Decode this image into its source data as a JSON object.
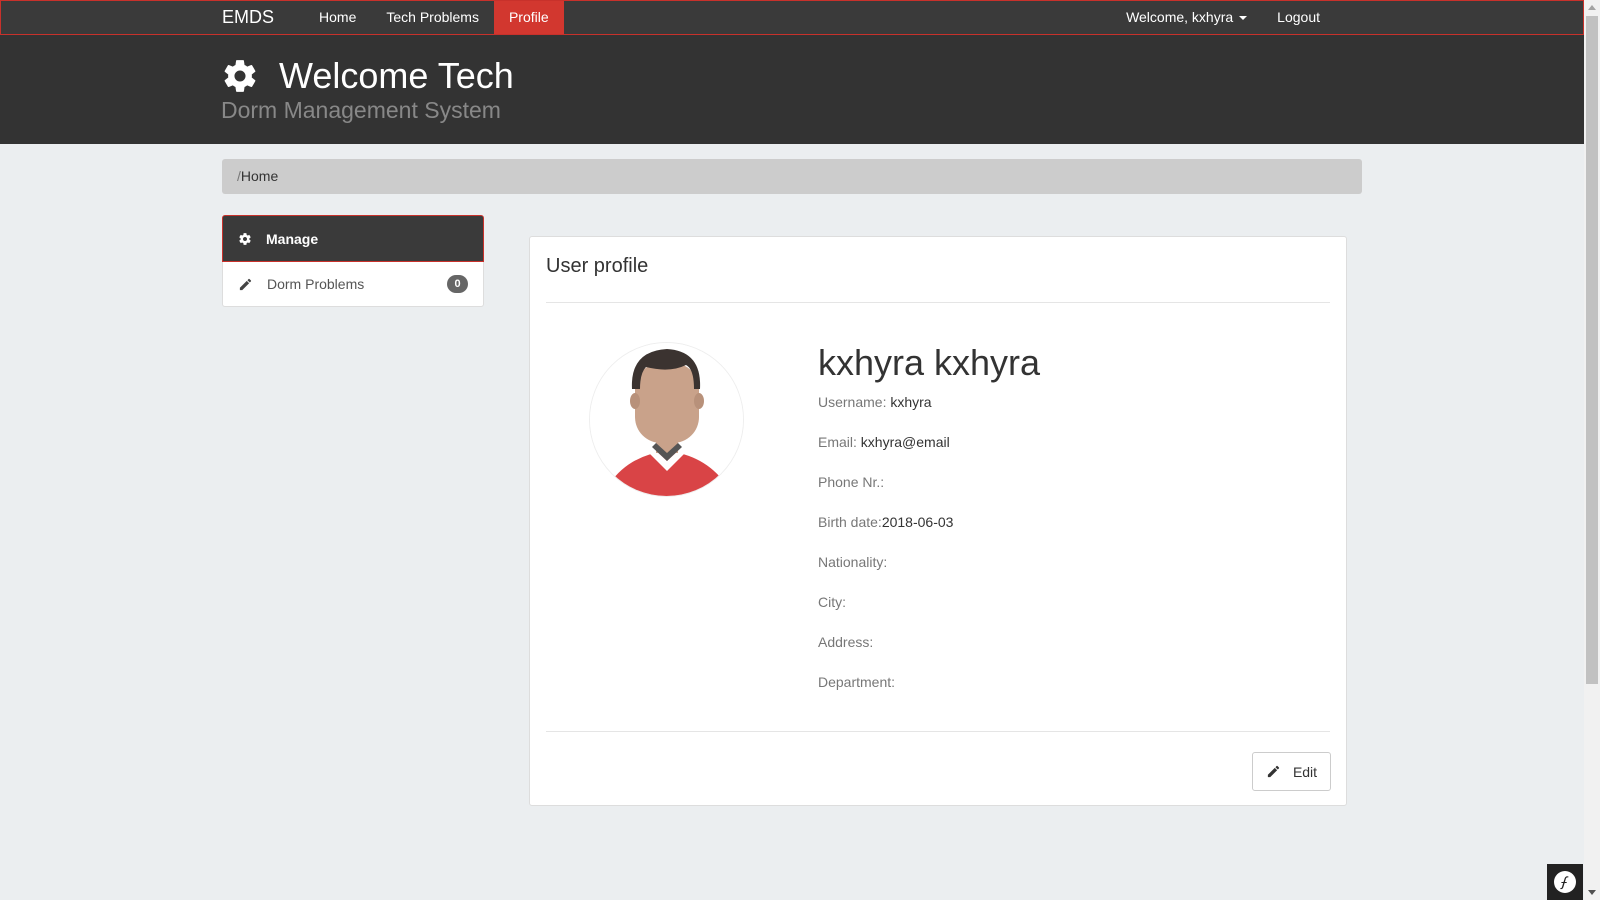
{
  "navbar": {
    "brand": "EMDS",
    "links": [
      {
        "label": "Home"
      },
      {
        "label": "Tech Problems"
      },
      {
        "label": "Profile"
      }
    ],
    "welcome": "Welcome, kxhyra",
    "logout": "Logout"
  },
  "header": {
    "title": "Welcome Tech",
    "subtitle": "Dorm Management System"
  },
  "breadcrumb": {
    "separator": "/",
    "current": "Home"
  },
  "sidebar": {
    "heading": "Manage",
    "items": [
      {
        "label": "Dorm Problems",
        "badge": "0"
      }
    ]
  },
  "profile": {
    "card_title": "User profile",
    "full_name": "kxhyra kxhyra",
    "fields": [
      {
        "label": "Username: ",
        "value": "kxhyra"
      },
      {
        "label": "Email: ",
        "value": "kxhyra@email"
      },
      {
        "label": "Phone Nr.:",
        "value": ""
      },
      {
        "label": "Birth date:",
        "value": "2018-06-03"
      },
      {
        "label": "Nationality:",
        "value": ""
      },
      {
        "label": "City:",
        "value": ""
      },
      {
        "label": "Address:",
        "value": ""
      },
      {
        "label": "Department:",
        "value": ""
      }
    ],
    "edit_label": "Edit"
  },
  "colors": {
    "navbar_bg": "#3a3a3a",
    "header_bg": "#333333",
    "accent_red": "#d2372f",
    "page_bg": "#ebeef0"
  }
}
